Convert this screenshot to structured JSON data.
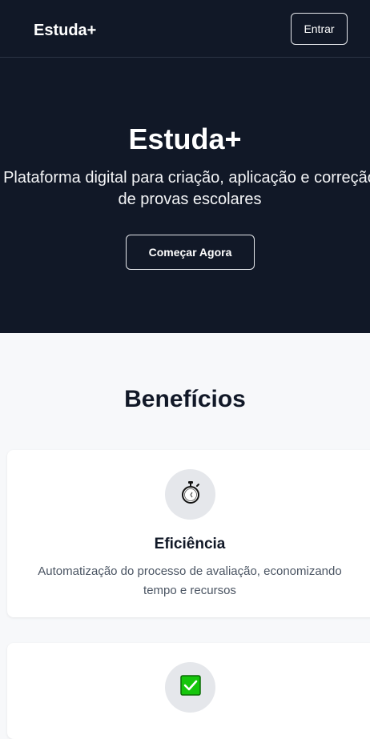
{
  "nav": {
    "logo": "Estuda+",
    "login_label": "Entrar"
  },
  "hero": {
    "title": "Estuda+",
    "subtitle_line1": "Plataforma digital para criação, aplicação e correção",
    "subtitle_line2": "de provas escolares",
    "cta_label": "Começar Agora"
  },
  "benefits": {
    "title": "Benefícios",
    "items": [
      {
        "icon": "stopwatch-icon",
        "title": "Eficiência",
        "desc_line1": "Automatização do processo de avaliação, economizando",
        "desc_line2": "tempo e recursos"
      },
      {
        "icon": "check-box-icon"
      }
    ]
  },
  "colors": {
    "dark_bg": "#111827",
    "light_bg": "#f7f8fa",
    "check_green": "#22c55e"
  }
}
